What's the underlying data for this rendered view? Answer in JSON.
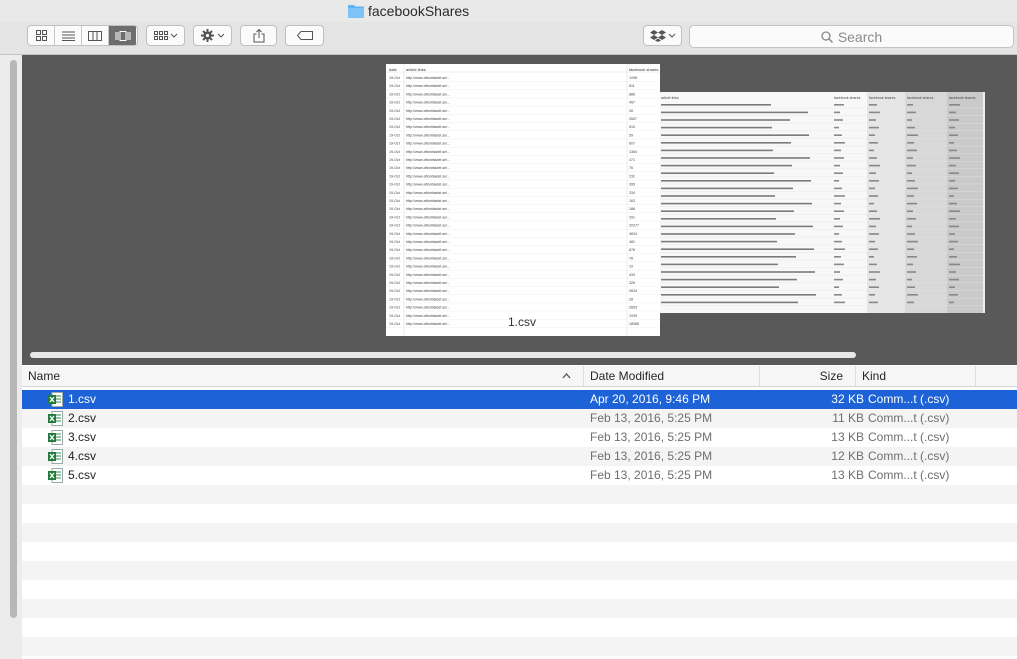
{
  "window": {
    "title": "facebookShares",
    "accent": "#1d62d6"
  },
  "toolbar": {
    "views": [
      "icon-view-icon",
      "list-view-icon",
      "column-view-icon",
      "cover-flow-icon"
    ],
    "arrange_icon": "grid-arrange-icon",
    "action_icon": "gear-icon",
    "share_icon": "share-icon",
    "tags_icon": "tag-icon",
    "dropbox_icon": "dropbox-icon",
    "search_placeholder": "Search"
  },
  "preview": {
    "caption": "1.csv",
    "doc_headers": [
      "date",
      "article links",
      "facebook shares"
    ],
    "doc_rows": [
      [
        "19-Oct",
        "http://www.aftonbladet.se/...",
        "1098"
      ],
      [
        "19-Oct",
        "http://www.aftonbladet.se/...",
        "811"
      ],
      [
        "19-Oct",
        "http://www.aftonbladet.se/...",
        "886"
      ],
      [
        "19-Oct",
        "http://www.aftonbladet.se/...",
        "457"
      ],
      [
        "19-Oct",
        "http://www.aftonbladet.se/...",
        "28"
      ],
      [
        "19-Oct",
        "http://www.aftonbladet.se/...",
        "2607"
      ],
      [
        "19-Oct",
        "http://www.aftonbladet.se/...",
        "515"
      ],
      [
        "19-Oct",
        "http://www.aftonbladet.se/...",
        "59"
      ],
      [
        "19-Oct",
        "http://www.aftonbladet.se/...",
        "607"
      ],
      [
        "19-Oct",
        "http://www.aftonbladet.se/...",
        "1364"
      ],
      [
        "19-Oct",
        "http://www.aftonbladet.se/...",
        "471"
      ],
      [
        "19-Oct",
        "http://www.aftonbladet.se/...",
        "76"
      ],
      [
        "19-Oct",
        "http://www.aftonbladet.se/...",
        "232"
      ],
      [
        "19-Oct",
        "http://www.aftonbladet.se/...",
        "395"
      ],
      [
        "19-Oct",
        "http://www.aftonbladet.se/...",
        "334"
      ],
      [
        "19-Oct",
        "http://www.aftonbladet.se/...",
        "163"
      ],
      [
        "19-Oct",
        "http://www.aftonbladet.se/...",
        "186"
      ],
      [
        "19-Oct",
        "http://www.aftonbladet.se/...",
        "291"
      ],
      [
        "19-Oct",
        "http://www.aftonbladet.se/...",
        "20377"
      ],
      [
        "19-Oct",
        "http://www.aftonbladet.se/...",
        "4634"
      ],
      [
        "19-Oct",
        "http://www.aftonbladet.se/...",
        "481"
      ],
      [
        "19-Oct",
        "http://www.aftonbladet.se/...",
        "876"
      ],
      [
        "19-Oct",
        "http://www.aftonbladet.se/...",
        "78"
      ],
      [
        "19-Oct",
        "http://www.aftonbladet.se/...",
        "19"
      ],
      [
        "19-Oct",
        "http://www.aftonbladet.se/...",
        "433"
      ],
      [
        "19-Oct",
        "http://www.aftonbladet.se/...",
        "326"
      ],
      [
        "19-Oct",
        "http://www.aftonbladet.se/...",
        "2634"
      ],
      [
        "19-Oct",
        "http://www.aftonbladet.se/...",
        "28"
      ],
      [
        "19-Oct",
        "http://www.aftonbladet.se/...",
        "2653"
      ],
      [
        "19-Oct",
        "http://www.aftonbladet.se/...",
        "1939"
      ],
      [
        "19-Oct",
        "http://www.aftonbladet.se/...",
        "18085"
      ]
    ],
    "side_headers": [
      "article links",
      "facebook shares",
      "facebook shares",
      "facebook shares",
      "facebook shares"
    ]
  },
  "columns": {
    "name": "Name",
    "date": "Date Modified",
    "size": "Size",
    "kind": "Kind",
    "sort_icon": "chevron-up-icon"
  },
  "files": [
    {
      "name": "1.csv",
      "date": "Apr 20, 2016, 9:46 PM",
      "size": "32 KB",
      "kind": "Comm...t (.csv)",
      "selected": true
    },
    {
      "name": "2.csv",
      "date": "Feb 13, 2016, 5:25 PM",
      "size": "11 KB",
      "kind": "Comm...t (.csv)",
      "selected": false
    },
    {
      "name": "3.csv",
      "date": "Feb 13, 2016, 5:25 PM",
      "size": "13 KB",
      "kind": "Comm...t (.csv)",
      "selected": false
    },
    {
      "name": "4.csv",
      "date": "Feb 13, 2016, 5:25 PM",
      "size": "12 KB",
      "kind": "Comm...t (.csv)",
      "selected": false
    },
    {
      "name": "5.csv",
      "date": "Feb 13, 2016, 5:25 PM",
      "size": "13 KB",
      "kind": "Comm...t (.csv)",
      "selected": false
    }
  ],
  "file_icon": "excel-file-icon"
}
